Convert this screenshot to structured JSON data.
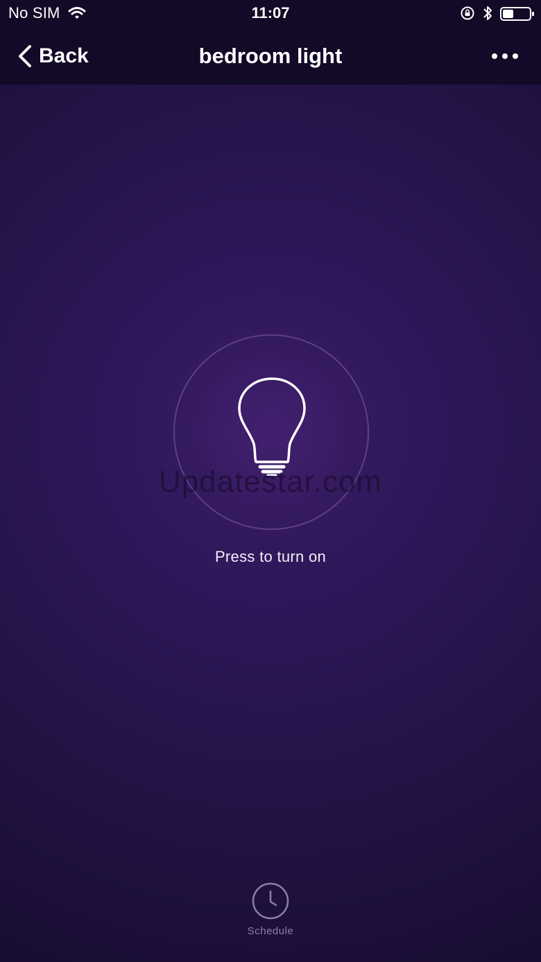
{
  "status_bar": {
    "carrier": "No SIM",
    "time": "11:07",
    "icons": [
      "wifi-icon",
      "orientation-lock-icon",
      "bluetooth-icon",
      "battery-icon"
    ]
  },
  "nav": {
    "back_label": "Back",
    "title": "bedroom light",
    "more_icon": "more-dots-icon"
  },
  "power": {
    "icon": "bulb-icon",
    "hint": "Press to turn on",
    "watermark": "Updatestar.com"
  },
  "schedule": {
    "icon": "clock-icon",
    "label": "Schedule"
  },
  "colors": {
    "background": "#241346",
    "bar": "#130a27",
    "text": "#ffffff",
    "muted": "#8c7fa3"
  }
}
